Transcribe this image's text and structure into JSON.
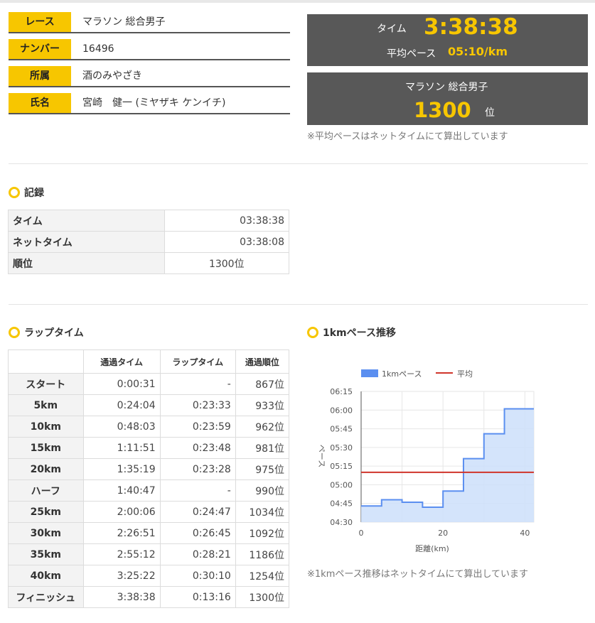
{
  "profile": [
    {
      "label": "レース",
      "value": "マラソン 総合男子"
    },
    {
      "label": "ナンバー",
      "value": "16496"
    },
    {
      "label": "所属",
      "value": "酒のみやざき"
    },
    {
      "label": "氏名",
      "value": "宮崎　健一 (ミヤザキ ケンイチ)"
    }
  ],
  "summary": {
    "time_label": "タイム",
    "time_value": "3:38:38",
    "pace_label": "平均ペース",
    "pace_value": "05:10/km",
    "category": "マラソン 総合男子",
    "rank_value": "1300",
    "rank_unit": "位",
    "note": "※平均ペースはネットタイムにて算出しています"
  },
  "record": {
    "title": "記録",
    "rows": [
      {
        "label": "タイム",
        "value": "03:38:38"
      },
      {
        "label": "ネットタイム",
        "value": "03:38:08"
      },
      {
        "label": "順位",
        "value": "1300位"
      }
    ]
  },
  "laps": {
    "title": "ラップタイム",
    "headers": [
      "",
      "通過タイム",
      "ラップタイム",
      "通過順位"
    ],
    "rows": [
      {
        "point": "スタート",
        "split": "0:00:31",
        "lap": "-",
        "rank": "867位"
      },
      {
        "point": "5km",
        "split": "0:24:04",
        "lap": "0:23:33",
        "rank": "933位"
      },
      {
        "point": "10km",
        "split": "0:48:03",
        "lap": "0:23:59",
        "rank": "962位"
      },
      {
        "point": "15km",
        "split": "1:11:51",
        "lap": "0:23:48",
        "rank": "981位"
      },
      {
        "point": "20km",
        "split": "1:35:19",
        "lap": "0:23:28",
        "rank": "975位"
      },
      {
        "point": "ハーフ",
        "split": "1:40:47",
        "lap": "-",
        "rank": "990位"
      },
      {
        "point": "25km",
        "split": "2:00:06",
        "lap": "0:24:47",
        "rank": "1034位"
      },
      {
        "point": "30km",
        "split": "2:26:51",
        "lap": "0:26:45",
        "rank": "1092位"
      },
      {
        "point": "35km",
        "split": "2:55:12",
        "lap": "0:28:21",
        "rank": "1186位"
      },
      {
        "point": "40km",
        "split": "3:25:22",
        "lap": "0:30:10",
        "rank": "1254位"
      },
      {
        "point": "フィニッシュ",
        "split": "3:38:38",
        "lap": "0:13:16",
        "rank": "1300位"
      }
    ]
  },
  "pace_chart": {
    "title": "1kmペース推移",
    "note": "※1kmペース推移はネットタイムにて算出しています",
    "colors": {
      "series": "#5b8ff0",
      "fill": "#cddffa",
      "average": "#d0352b"
    }
  },
  "chart_data": {
    "type": "area",
    "xlabel": "距離(km)",
    "ylabel": "ペース",
    "xlim": [
      0,
      42.195
    ],
    "x_ticks": [
      "0",
      "20",
      "40"
    ],
    "y_ticks": [
      "04:30",
      "04:45",
      "05:00",
      "05:15",
      "05:30",
      "05:45",
      "06:00",
      "06:15"
    ],
    "ylim_seconds": [
      270,
      375
    ],
    "legend_position": "top",
    "series": [
      {
        "name": "1kmペース",
        "x": [
          0,
          5,
          10,
          15,
          20,
          25,
          30,
          35,
          40,
          42.195
        ],
        "y": [
          "04:43",
          "04:48",
          "04:46",
          "04:42",
          "04:55",
          "05:21",
          "05:41",
          "06:01",
          "06:01",
          "06:01"
        ]
      },
      {
        "name": "平均",
        "x": [
          0,
          42.195
        ],
        "y": [
          "05:10",
          "05:10"
        ]
      }
    ]
  }
}
